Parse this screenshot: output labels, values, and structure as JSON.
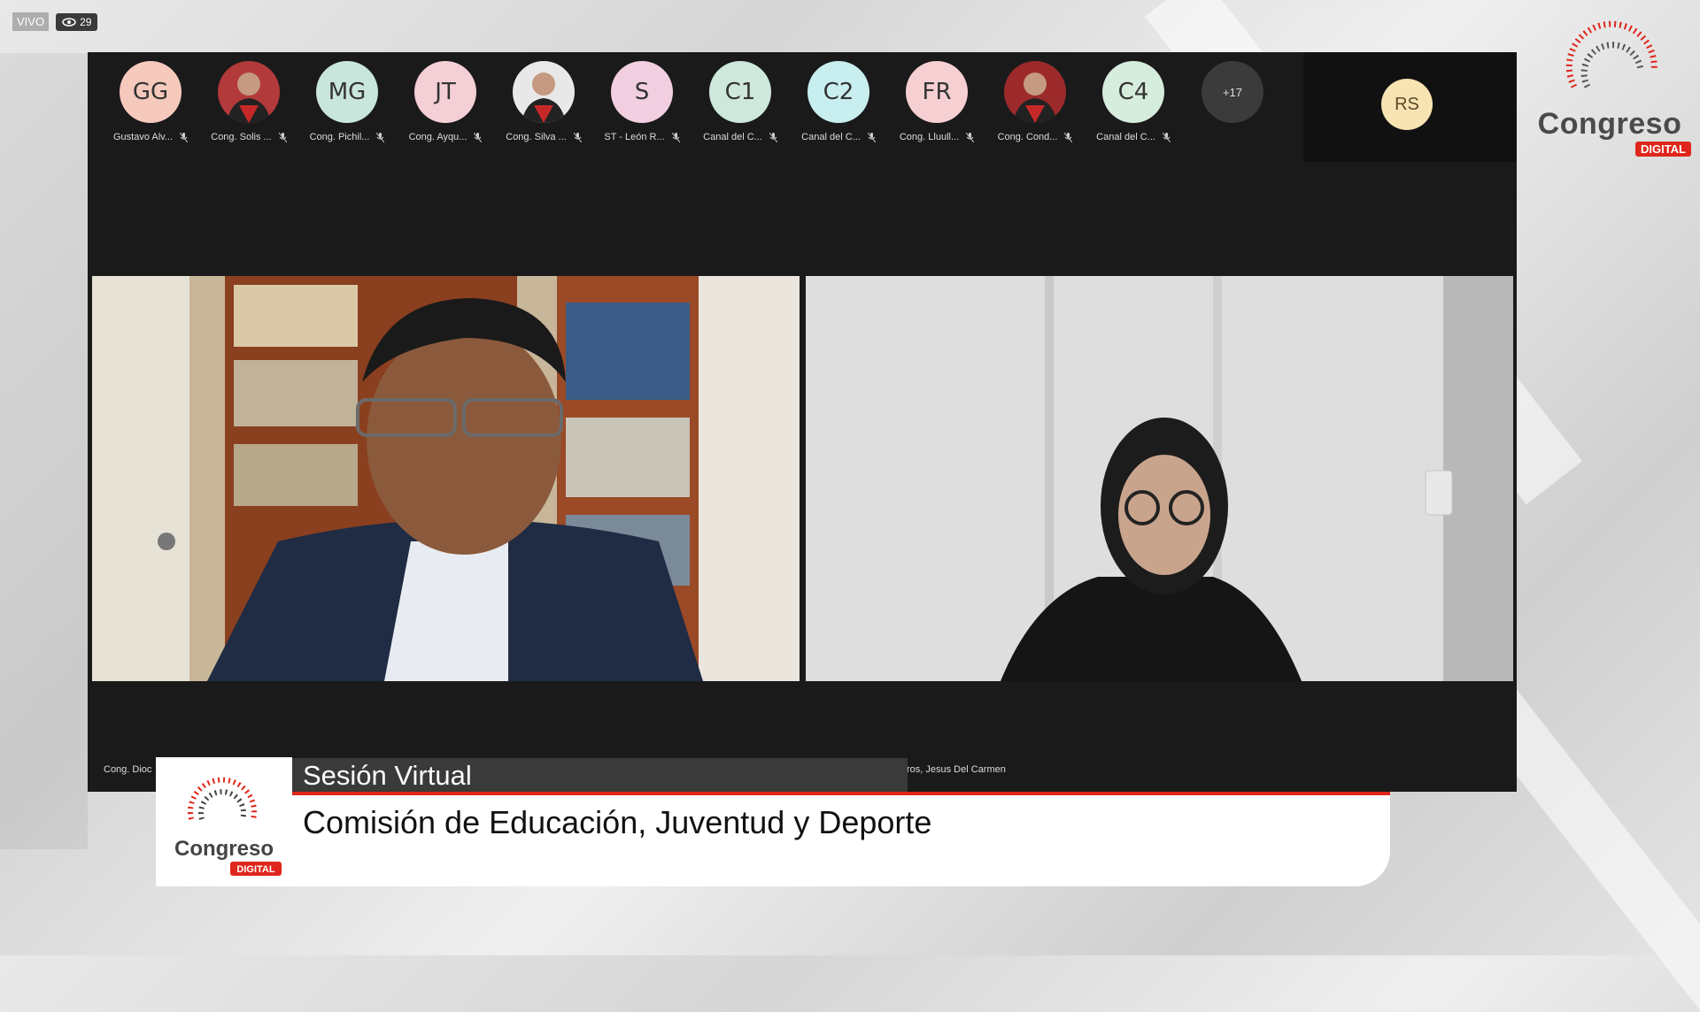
{
  "stream": {
    "live_label": "VIVO",
    "viewer_count": "29"
  },
  "participants": [
    {
      "initials": "GG",
      "name": "Gustavo Alv...",
      "color": "#f6c9bd"
    },
    {
      "initials": "",
      "name": "Cong. Solis ...",
      "color": "#b33a3a",
      "photo": true
    },
    {
      "initials": "MG",
      "name": "Cong. Pichil...",
      "color": "#c9e6dc"
    },
    {
      "initials": "JT",
      "name": "Cong. Ayqu...",
      "color": "#f4cfd6"
    },
    {
      "initials": "",
      "name": "Cong. Silva ...",
      "color": "#e8e8e8",
      "photo": true
    },
    {
      "initials": "S",
      "name": "ST - León R...",
      "color": "#f2cfe0"
    },
    {
      "initials": "C1",
      "name": "Canal del C...",
      "color": "#cfe8dc"
    },
    {
      "initials": "C2",
      "name": "Canal del C...",
      "color": "#c9eef0"
    },
    {
      "initials": "FR",
      "name": "Cong. Lluull...",
      "color": "#f6cfd3"
    },
    {
      "initials": "",
      "name": "Cong. Cond...",
      "color": "#9c2a2a",
      "photo": true
    },
    {
      "initials": "C4",
      "name": "Canal del C...",
      "color": "#d6ecdc"
    }
  ],
  "more_count": "+17",
  "self_view": {
    "initials": "RS",
    "color": "#f8e3b3"
  },
  "tiles": {
    "left_label": "Cong. Dioc",
    "right_label": "ros, Jesus Del Carmen"
  },
  "lower_third": {
    "session_label": "Sesión Virtual",
    "title": "Comisión de Educación, Juventud y Deporte"
  },
  "brand": {
    "name": "Congreso",
    "tag": "DIGITAL",
    "accent": "#e0261c"
  }
}
